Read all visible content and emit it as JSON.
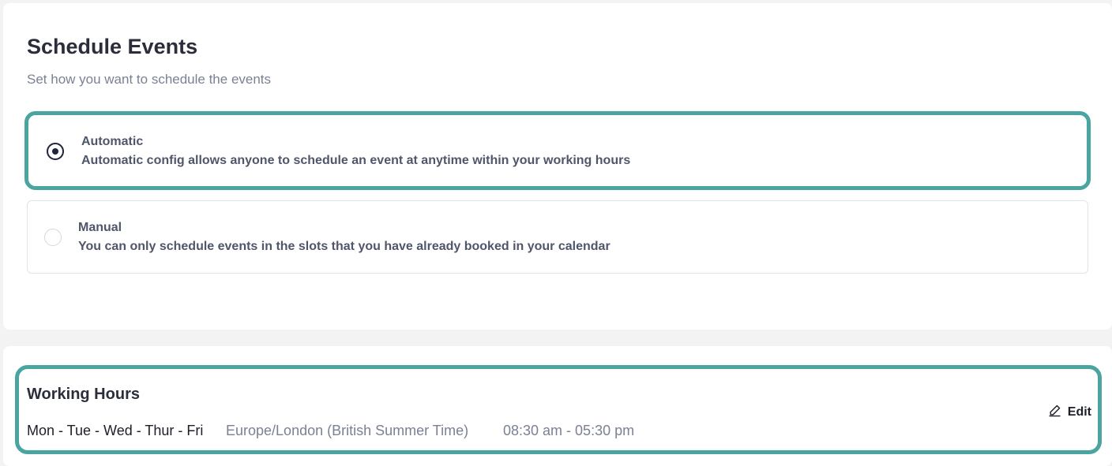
{
  "schedule": {
    "title": "Schedule Events",
    "subtitle": "Set how you want to schedule the events",
    "options": [
      {
        "label": "Automatic",
        "description": "Automatic config allows anyone to schedule an event at anytime within your working hours",
        "selected": true
      },
      {
        "label": "Manual",
        "description": "You can only schedule events in the slots that you have already booked in your calendar",
        "selected": false
      }
    ]
  },
  "working_hours": {
    "title": "Working Hours",
    "days": "Mon - Tue - Wed - Thur - Fri",
    "timezone": "Europe/London (British Summer Time)",
    "time_range": "08:30 am - 05:30 pm",
    "edit_label": "Edit",
    "edit_icon": "pencil-icon"
  },
  "colors": {
    "highlight_border": "#4aa5a0",
    "radio_selected": "#1e2340",
    "muted_text": "#7b8194"
  }
}
